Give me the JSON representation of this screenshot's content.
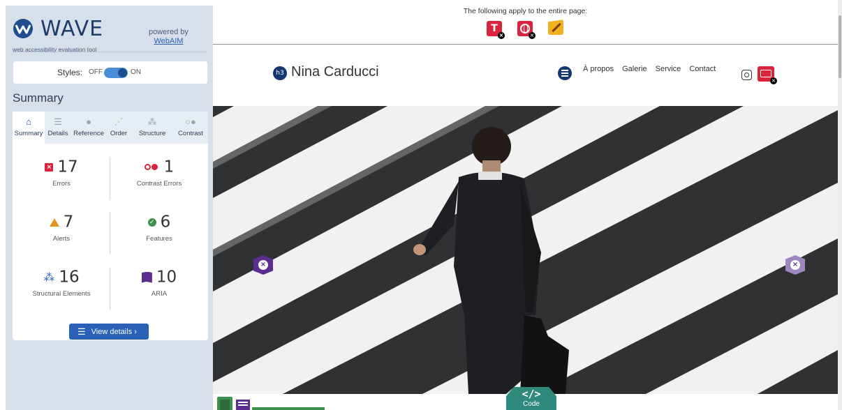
{
  "wave": {
    "name": "WAVE",
    "tagline": "web accessibility evaluation tool",
    "powered_by": "powered by",
    "webaim": "WebAIM",
    "styles_label": "Styles:",
    "styles_off": "OFF",
    "styles_on": "ON",
    "styles_enabled": true,
    "section_title": "Summary",
    "tabs": [
      {
        "label": "Summary",
        "icon": "home-icon",
        "active": true
      },
      {
        "label": "Details",
        "icon": "list-icon",
        "active": false
      },
      {
        "label": "Reference",
        "icon": "info-icon",
        "active": false
      },
      {
        "label": "Order",
        "icon": "order-icon",
        "active": false
      },
      {
        "label": "Structure",
        "icon": "structure-icon",
        "active": false
      },
      {
        "label": "Contrast",
        "icon": "contrast-icon",
        "active": false
      }
    ],
    "stats": {
      "errors": {
        "count": "17",
        "label": "Errors"
      },
      "contrast_errors": {
        "count": "1",
        "label": "Contrast Errors"
      },
      "alerts": {
        "count": "7",
        "label": "Alerts"
      },
      "features": {
        "count": "6",
        "label": "Features"
      },
      "structural": {
        "count": "16",
        "label": "Structural Elements"
      },
      "aria": {
        "count": "10",
        "label": "ARIA"
      }
    },
    "view_details": "View details ›"
  },
  "page_notice": "The following apply to the entire page:",
  "site": {
    "heading_badge": "h3",
    "title": "Nina Carducci",
    "nav": [
      "À propos",
      "Galerie",
      "Service",
      "Contact"
    ]
  },
  "code_button": {
    "glyph": "</>",
    "label": "Code"
  },
  "colors": {
    "sidebar_bg": "#d6dfea",
    "accent": "#2a61b6",
    "error": "#d9243b",
    "alert": "#e2941c",
    "feature": "#3f8f4f",
    "aria": "#5b2d8f",
    "code": "#2f8a7d"
  }
}
